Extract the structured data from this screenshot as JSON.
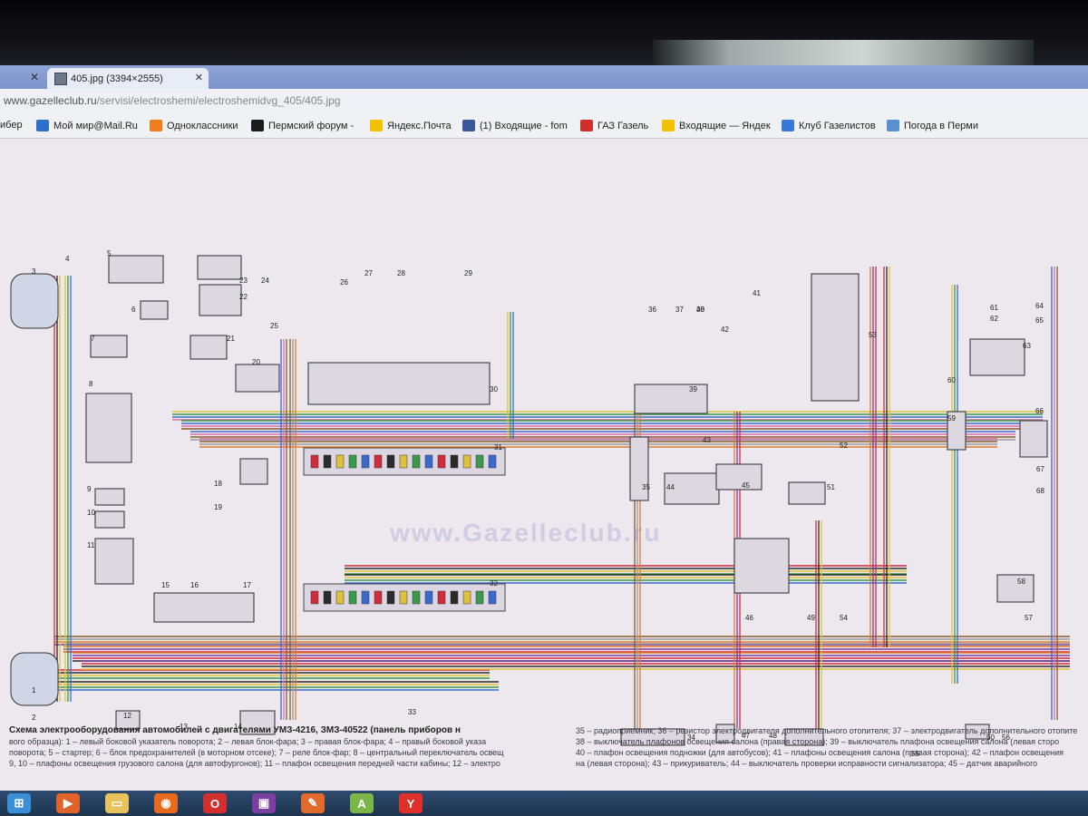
{
  "browser": {
    "tab_title": "405.jpg (3394×2555)",
    "url_domain": "www.gazelleclub.ru",
    "url_path": "/servisi/electroshemi/electroshemidvg_405/405.jpg",
    "bookmarks": [
      {
        "label": "ибер",
        "color": "#3b6fb6"
      },
      {
        "label": "Мой мир@Mail.Ru",
        "color": "#2d6fcc"
      },
      {
        "label": "Одноклассники",
        "color": "#f07d1a"
      },
      {
        "label": "Пермский форум -",
        "color": "#1a1a1a"
      },
      {
        "label": "Яндекс.Почта",
        "color": "#f2c200"
      },
      {
        "label": "(1) Входящие - fom",
        "color": "#3b5998"
      },
      {
        "label": "ГАЗ Газель",
        "color": "#d0302a"
      },
      {
        "label": "Входящие — Яндек",
        "color": "#f2c200"
      },
      {
        "label": "Клуб Газелистов",
        "color": "#3a78d8"
      },
      {
        "label": "Погода в Перми",
        "color": "#5a8fd0"
      }
    ]
  },
  "diagram": {
    "watermark": "www.Gazelleclub.ru",
    "component_numbers": [
      "1",
      "2",
      "3",
      "4",
      "5",
      "6",
      "7",
      "8",
      "9",
      "10",
      "11",
      "12",
      "13",
      "14",
      "15",
      "16",
      "17",
      "18",
      "19",
      "20",
      "21",
      "22",
      "23",
      "24",
      "25",
      "26",
      "27",
      "28",
      "29",
      "30",
      "31",
      "32",
      "33",
      "34",
      "35",
      "36",
      "37",
      "38",
      "39",
      "40",
      "41",
      "42",
      "43",
      "44",
      "45",
      "46",
      "47",
      "48",
      "49",
      "50",
      "51",
      "52",
      "53",
      "54",
      "55",
      "56",
      "57",
      "58",
      "59",
      "60",
      "61",
      "62",
      "63",
      "64",
      "65",
      "66",
      "67",
      "68"
    ]
  },
  "caption": {
    "title": "Схема электрооборудования автомобилей с двигателями УМЗ-4216, ЗМЗ-40522 (панель приборов н",
    "left_lines": [
      "вого образца): 1 – левый боковой указатель поворота; 2 – левая блок-фара; 3 – правая блок-фара; 4 – правый боковой указа",
      "поворота; 5 – стартер; 6 – блок предохранителей (в моторном отсеке); 7 – реле блок-фар; 8 – центральный переключатель освещ",
      "9, 10 – плафоны освещения грузового салона (для автофургонов); 11 – плафон освещения передней части кабины; 12 – электро"
    ],
    "right_lines": [
      "35 – радиоприемник; 36 – резистор электродвигателя дополнительного отопителя; 37 – электродвигатель дополнительного отопите",
      "38 – выключатель плафонов освещения салона (правая сторона); 39 – выключатель плафона освещения салона (левая сторо",
      "40 – плафон освещения подножки (для автобусов); 41 – плафоны освещения салона (правая сторона); 42 – плафон освещения",
      "на (левая сторона); 43 – прикуриватель; 44 – выключатель проверки исправности сигнализатора; 45 – датчик аварийного"
    ]
  },
  "taskbar": {
    "icons": [
      {
        "name": "start-orb-icon",
        "color": "#3a8fd8"
      },
      {
        "name": "media-player-icon",
        "color": "#e0632a"
      },
      {
        "name": "file-explorer-icon",
        "color": "#e8c25a"
      },
      {
        "name": "firefox-icon",
        "color": "#e86a1f"
      },
      {
        "name": "opera-icon",
        "color": "#d32f2f"
      },
      {
        "name": "app-icon",
        "color": "#7a3fa0"
      },
      {
        "name": "paint-icon",
        "color": "#e26a2c"
      },
      {
        "name": "android-icon",
        "color": "#7ab648"
      },
      {
        "name": "yandex-browser-icon",
        "color": "#e0302a"
      }
    ]
  }
}
